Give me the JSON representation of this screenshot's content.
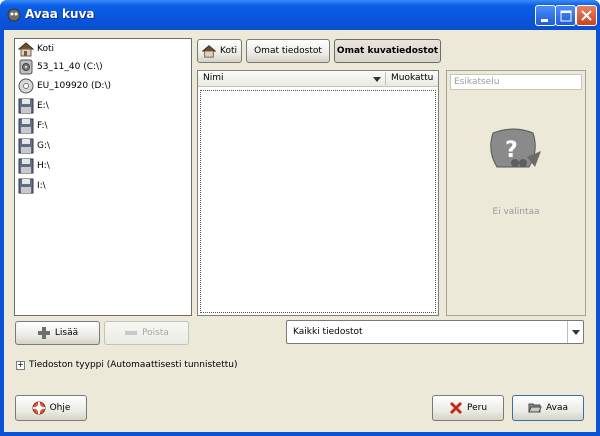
{
  "window": {
    "title": "Avaa kuva"
  },
  "titlebar": {
    "minimize": "minimize",
    "maximize": "maximize",
    "close": "close"
  },
  "places": [
    {
      "label": "Koti",
      "icon": "home-icon"
    },
    {
      "label": "53_11_40 (C:\\)",
      "icon": "harddisk-icon"
    },
    {
      "label": "EU_109920 (D:\\)",
      "icon": "cdrom-icon"
    },
    {
      "label": "E:\\",
      "icon": "floppy-icon"
    },
    {
      "label": "F:\\",
      "icon": "floppy-icon"
    },
    {
      "label": "G:\\",
      "icon": "floppy-icon"
    },
    {
      "label": "H:\\",
      "icon": "floppy-icon"
    },
    {
      "label": "I:\\",
      "icon": "floppy-icon"
    }
  ],
  "path_bar": {
    "home": "Koti",
    "my_files": "Omat tiedostot",
    "my_images": "Omat kuvatiedostot"
  },
  "file_list": {
    "col_name": "Nimi",
    "col_modified": "Muokattu"
  },
  "preview": {
    "label": "Esikatselu",
    "empty": "Ei valintaa"
  },
  "places_buttons": {
    "add": "Lisää",
    "remove": "Poista"
  },
  "filter": {
    "selected": "Kaikki tiedostot"
  },
  "file_type": {
    "label": "Tiedoston tyyppi (Automaattisesti tunnistettu)"
  },
  "buttons": {
    "help": "Ohje",
    "cancel": "Peru",
    "open": "Avaa"
  }
}
